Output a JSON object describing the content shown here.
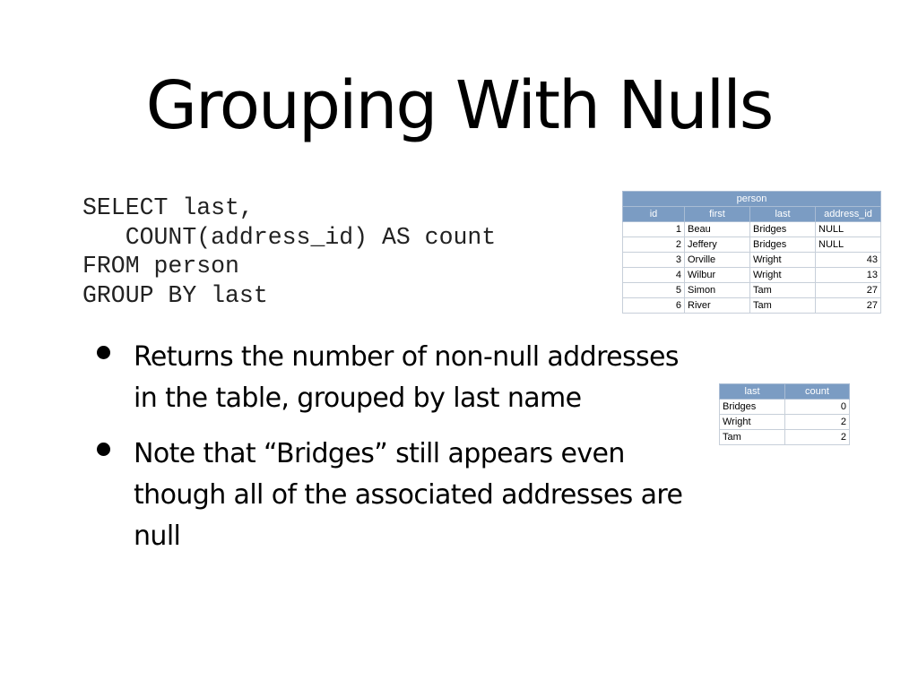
{
  "slide": {
    "title": "Grouping With Nulls",
    "code_lines": [
      "SELECT last,",
      "   COUNT(address_id) AS count",
      "FROM person",
      "GROUP BY last"
    ],
    "bullets": [
      "Returns the number of non-null addresses in the table, grouped by last name",
      "Note that “Bridges” still appears even though all of the associated addresses are null"
    ]
  },
  "person_table": {
    "caption": "person",
    "columns": [
      "id",
      "first",
      "last",
      "address_id"
    ],
    "rows": [
      [
        "1",
        "Beau",
        "Bridges",
        "NULL"
      ],
      [
        "2",
        "Jeffery",
        "Bridges",
        "NULL"
      ],
      [
        "3",
        "Orville",
        "Wright",
        "43"
      ],
      [
        "4",
        "Wilbur",
        "Wright",
        "13"
      ],
      [
        "5",
        "Simon",
        "Tam",
        "27"
      ],
      [
        "6",
        "River",
        "Tam",
        "27"
      ]
    ]
  },
  "result_table": {
    "columns": [
      "last",
      "count"
    ],
    "rows": [
      [
        "Bridges",
        "0"
      ],
      [
        "Wright",
        "2"
      ],
      [
        "Tam",
        "2"
      ]
    ]
  },
  "colors": {
    "header_bg": "#7b9cc3",
    "header_text": "#ffffff",
    "grid": "#c7cfd9"
  }
}
